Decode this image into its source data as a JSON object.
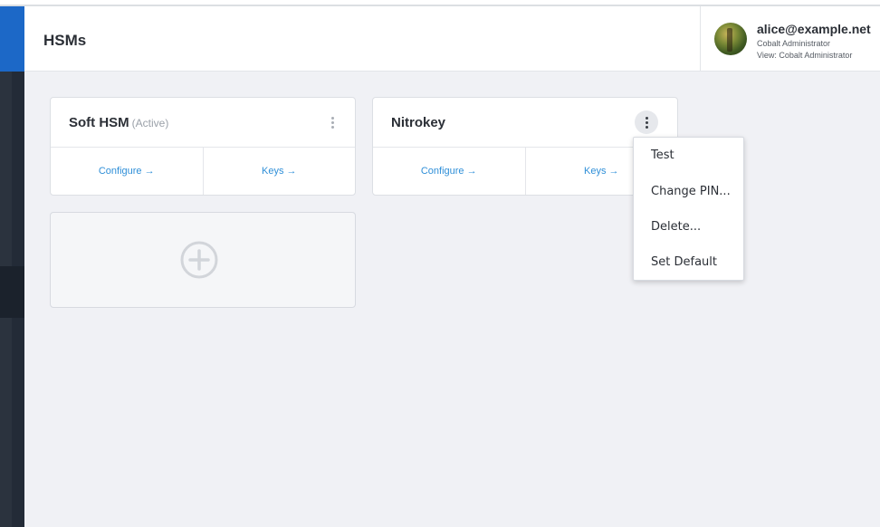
{
  "header": {
    "title": "HSMs"
  },
  "user": {
    "email": "alice@example.net",
    "role": "Cobalt Administrator",
    "view": "View: Cobalt Administrator"
  },
  "cards": [
    {
      "name": "Soft HSM",
      "status": "(Active)",
      "configure_label": "Configure →",
      "keys_label": "Keys →"
    },
    {
      "name": "Nitrokey",
      "status": "",
      "configure_label": "Configure →",
      "keys_label": "Keys →"
    }
  ],
  "context_menu": {
    "items": [
      {
        "label": "Test"
      },
      {
        "label": "Change PIN..."
      },
      {
        "label": "Delete..."
      },
      {
        "label": "Set Default"
      }
    ]
  },
  "colors": {
    "sidebar": "#232b37",
    "sidebar_accent": "#1c68c7",
    "link": "#2f8fd8",
    "content_bg": "#f0f1f5"
  },
  "icons": {
    "add": "plus-circle-icon",
    "menu": "kebab-menu-icon",
    "user": "avatar"
  }
}
